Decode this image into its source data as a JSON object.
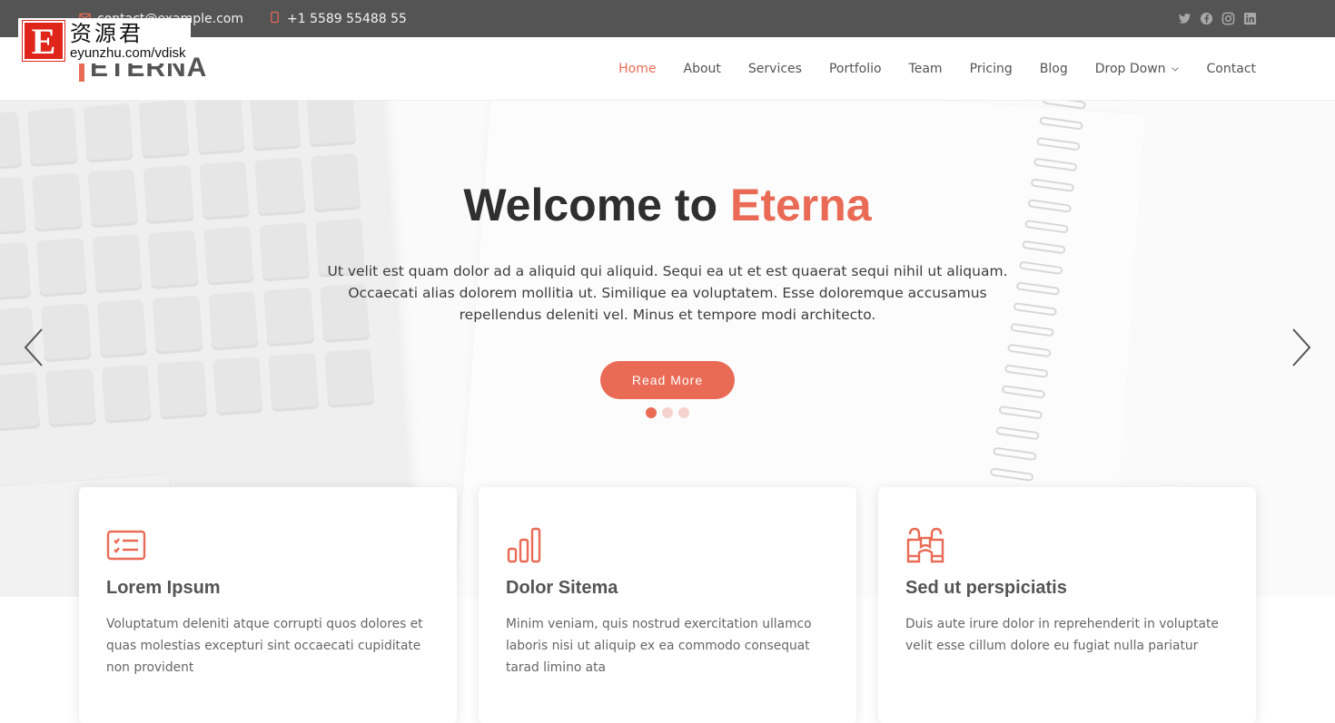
{
  "topbar": {
    "email": "contact@example.com",
    "phone": "+1 5589 55488 55",
    "email_icon": "envelope-icon",
    "phone_icon": "phone-icon",
    "social": [
      "twitter-icon",
      "facebook-icon",
      "instagram-icon",
      "linkedin-icon"
    ]
  },
  "watermark": {
    "letter": "E",
    "chinese": "资源君",
    "url": "eyunzhu.com/vdisk"
  },
  "header": {
    "logo": "ETERNA",
    "nav": [
      {
        "label": "Home",
        "active": true
      },
      {
        "label": "About"
      },
      {
        "label": "Services"
      },
      {
        "label": "Portfolio"
      },
      {
        "label": "Team"
      },
      {
        "label": "Pricing"
      },
      {
        "label": "Blog"
      },
      {
        "label": "Drop Down",
        "dropdown": true
      },
      {
        "label": "Contact"
      }
    ]
  },
  "hero": {
    "title_prefix": "Welcome to ",
    "title_accent": "Eterna",
    "text": "Ut velit est quam dolor ad a aliquid qui aliquid. Sequi ea ut et est quaerat sequi nihil ut aliquam. Occaecati alias dolorem mollitia ut. Similique ea voluptatem. Esse doloremque accusamus repellendus deleniti vel. Minus et tempore modi architecto.",
    "button": "Read More",
    "slides_total": 3,
    "active_slide": 1
  },
  "colors": {
    "accent": "#e96b56",
    "topbar_bg": "#545454",
    "text_dark": "#545454"
  },
  "cards": [
    {
      "icon": "checklist-icon",
      "title": "Lorem Ipsum",
      "text": "Voluptatum deleniti atque corrupti quos dolores et quas molestias excepturi sint occaecati cupiditate non provident"
    },
    {
      "icon": "bar-chart-icon",
      "title": "Dolor Sitema",
      "text": "Minim veniam, quis nostrud exercitation ullamco laboris nisi ut aliquip ex ea commodo consequat tarad limino ata"
    },
    {
      "icon": "binoculars-icon",
      "title": "Sed ut perspiciatis",
      "text": "Duis aute irure dolor in reprehenderit in voluptate velit esse cillum dolore eu fugiat nulla pariatur"
    }
  ]
}
